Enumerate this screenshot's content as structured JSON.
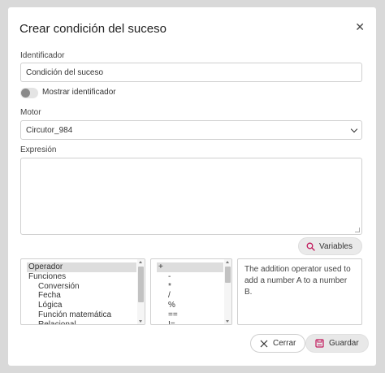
{
  "dialog": {
    "title": "Crear condición del suceso"
  },
  "identifier": {
    "label": "Identificador",
    "value": "Condición del suceso"
  },
  "toggle": {
    "label": "Mostrar identificador",
    "on": false
  },
  "motor": {
    "label": "Motor",
    "value": "Circutor_984"
  },
  "expression": {
    "label": "Expresión",
    "value": ""
  },
  "variables_button": {
    "label": "Variables",
    "icon": "search-icon"
  },
  "categories": [
    {
      "label": "Operador",
      "selected": true,
      "indent": 0
    },
    {
      "label": "Funciones",
      "selected": false,
      "indent": 0
    },
    {
      "label": "Conversión",
      "selected": false,
      "indent": 1
    },
    {
      "label": "Fecha",
      "selected": false,
      "indent": 1
    },
    {
      "label": "Lógica",
      "selected": false,
      "indent": 1
    },
    {
      "label": "Función matemática",
      "selected": false,
      "indent": 1
    },
    {
      "label": "Relacional",
      "selected": false,
      "indent": 1
    }
  ],
  "operators": [
    "+",
    "-",
    "*",
    "/",
    "%",
    "==",
    "!="
  ],
  "description": "The addition operator used to add a number A to a number B.",
  "footer": {
    "close_label": "Cerrar",
    "save_label": "Guardar",
    "accent": "#c2185b"
  }
}
